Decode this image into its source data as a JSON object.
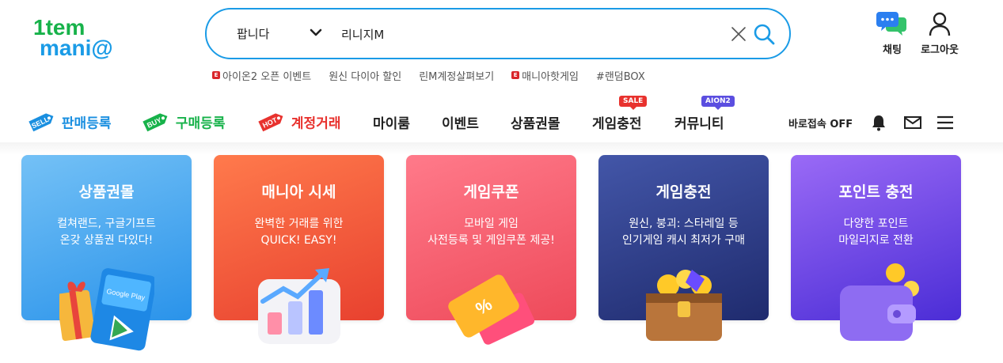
{
  "brand": {
    "logo_top": "1tem",
    "logo_bottom": "mani@"
  },
  "search": {
    "category": "팝니다",
    "query": "리니지M",
    "placeholder": ""
  },
  "hot_links": [
    {
      "label": "아이온2 오픈 이벤트",
      "event_badge": true
    },
    {
      "label": "원신 다이아 할인",
      "event_badge": false
    },
    {
      "label": "린M계정살펴보기",
      "event_badge": false
    },
    {
      "label": "매니아핫게임",
      "event_badge": true
    },
    {
      "label": "#랜덤BOX",
      "event_badge": false
    }
  ],
  "event_badge_text": "E",
  "header_icons": {
    "chat": "채팅",
    "logout": "로그아웃"
  },
  "nav": {
    "sell": {
      "tag": "SELL",
      "label": "판매등록"
    },
    "buy": {
      "tag": "BUY",
      "label": "구매등록"
    },
    "account": {
      "tag": "HOT",
      "label": "계정거래"
    },
    "items": [
      "마이룸",
      "이벤트",
      "상품권몰",
      "게임충전",
      "커뮤니티"
    ],
    "sale_pill": "SALE",
    "aion_pill": "AION2",
    "quick_access": "바로접속 OFF"
  },
  "cards": [
    {
      "title": "상품권몰",
      "desc1": "컬쳐랜드, 구글기프트",
      "desc2": "온갖 상품권 다있다!"
    },
    {
      "title": "매니아 시세",
      "desc1": "완벽한 거래를 위한",
      "desc2": "QUICK! EASY!"
    },
    {
      "title": "게임쿠폰",
      "desc1": "모바일 게임",
      "desc2": "사전등록 및 게임쿠폰 제공!"
    },
    {
      "title": "게임충전",
      "desc1": "원신, 붕괴: 스타레일 등",
      "desc2": "인기게임 캐시 최저가 구매"
    },
    {
      "title": "포인트 충전",
      "desc1": "다양한 포인트",
      "desc2": "마일리지로 전환"
    }
  ],
  "art_text": {
    "google_play": "Google Play",
    "coupon_symbol": "%"
  },
  "colors": {
    "accent": "#1a9be6",
    "logo_green": "#17b24a",
    "logo_blue": "#1a9be6",
    "nav_sell": "#1a8fe0",
    "nav_buy": "#17b24a",
    "nav_hot": "#e8322e",
    "card_gift": "#3aa5f0",
    "card_market": "#f2542f",
    "card_coupon": "#f25a6e",
    "card_charge": "#2f3d8a",
    "card_point": "#6a3fe0"
  }
}
